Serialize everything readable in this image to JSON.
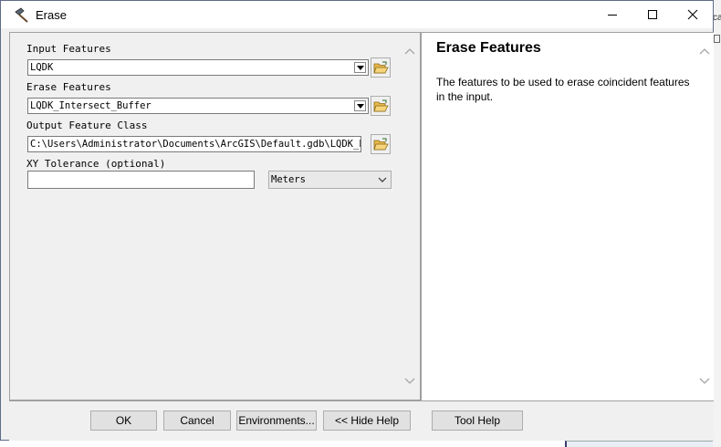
{
  "window": {
    "title": "Erase"
  },
  "background_app": {
    "fragment_text": "ca"
  },
  "form": {
    "input_features": {
      "label": "Input Features",
      "value": "LQDK"
    },
    "erase_features": {
      "label": "Erase Features",
      "value": "LQDK_Intersect_Buffer"
    },
    "output_feature_class": {
      "label": "Output Feature Class",
      "value": "C:\\Users\\Administrator\\Documents\\ArcGIS\\Default.gdb\\LQDK_Era"
    },
    "xy_tolerance": {
      "label": "XY Tolerance (optional)",
      "value": "",
      "unit": "Meters"
    }
  },
  "help": {
    "title": "Erase Features",
    "body": "The features to be used to erase coincident features in the input."
  },
  "buttons": {
    "ok": "OK",
    "cancel": "Cancel",
    "environments": "Environments...",
    "hide_help": "<< Hide Help",
    "tool_help": "Tool Help"
  },
  "icons": {
    "title_icon": "hammer-icon",
    "browse": "open-folder-icon",
    "dropdown": "chevron-down-icon"
  }
}
